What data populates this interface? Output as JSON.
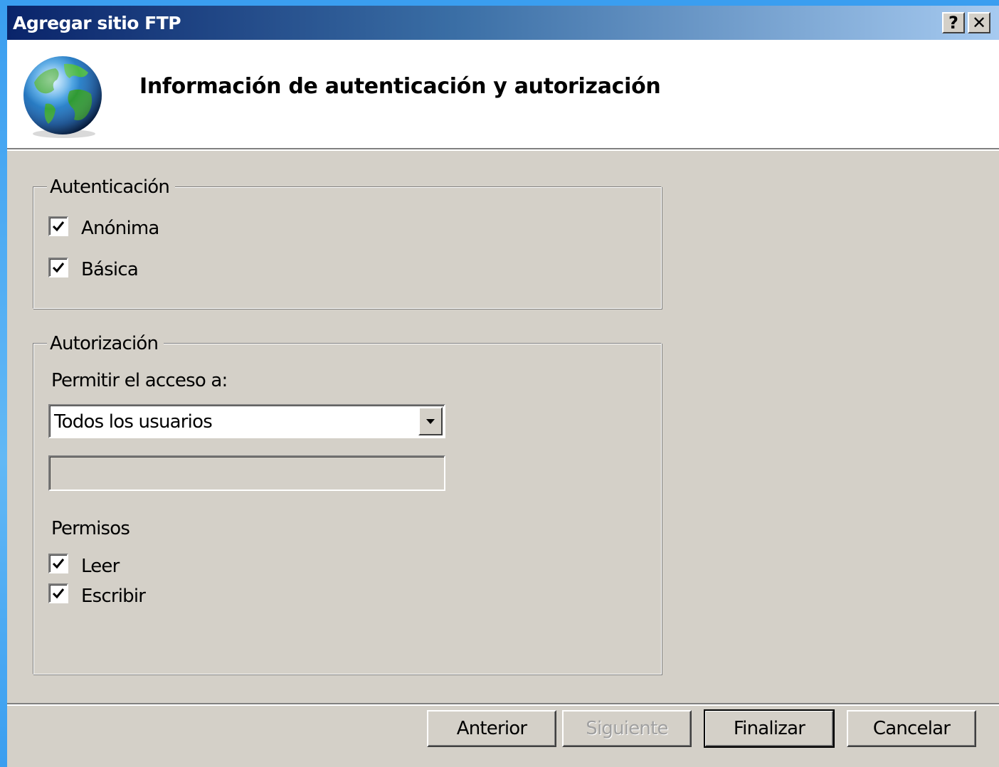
{
  "window": {
    "title": "Agregar sitio FTP",
    "help_button": "?",
    "close_button": "✕"
  },
  "header": {
    "title": "Información de autenticación y autorización",
    "icon": "globe-icon"
  },
  "authentication": {
    "legend": "Autenticación",
    "options": [
      {
        "label": "Anónima",
        "checked": true
      },
      {
        "label": "Básica",
        "checked": true
      }
    ]
  },
  "authorization": {
    "legend": "Autorización",
    "allow_access_label": "Permitir el acceso a:",
    "allow_access_value": "Todos los usuarios",
    "permissions_label": "Permisos",
    "permissions": [
      {
        "label": "Leer",
        "checked": true
      },
      {
        "label": "Escribir",
        "checked": true
      }
    ]
  },
  "buttons": {
    "previous": "Anterior",
    "next": "Siguiente",
    "finish": "Finalizar",
    "cancel": "Cancelar"
  }
}
